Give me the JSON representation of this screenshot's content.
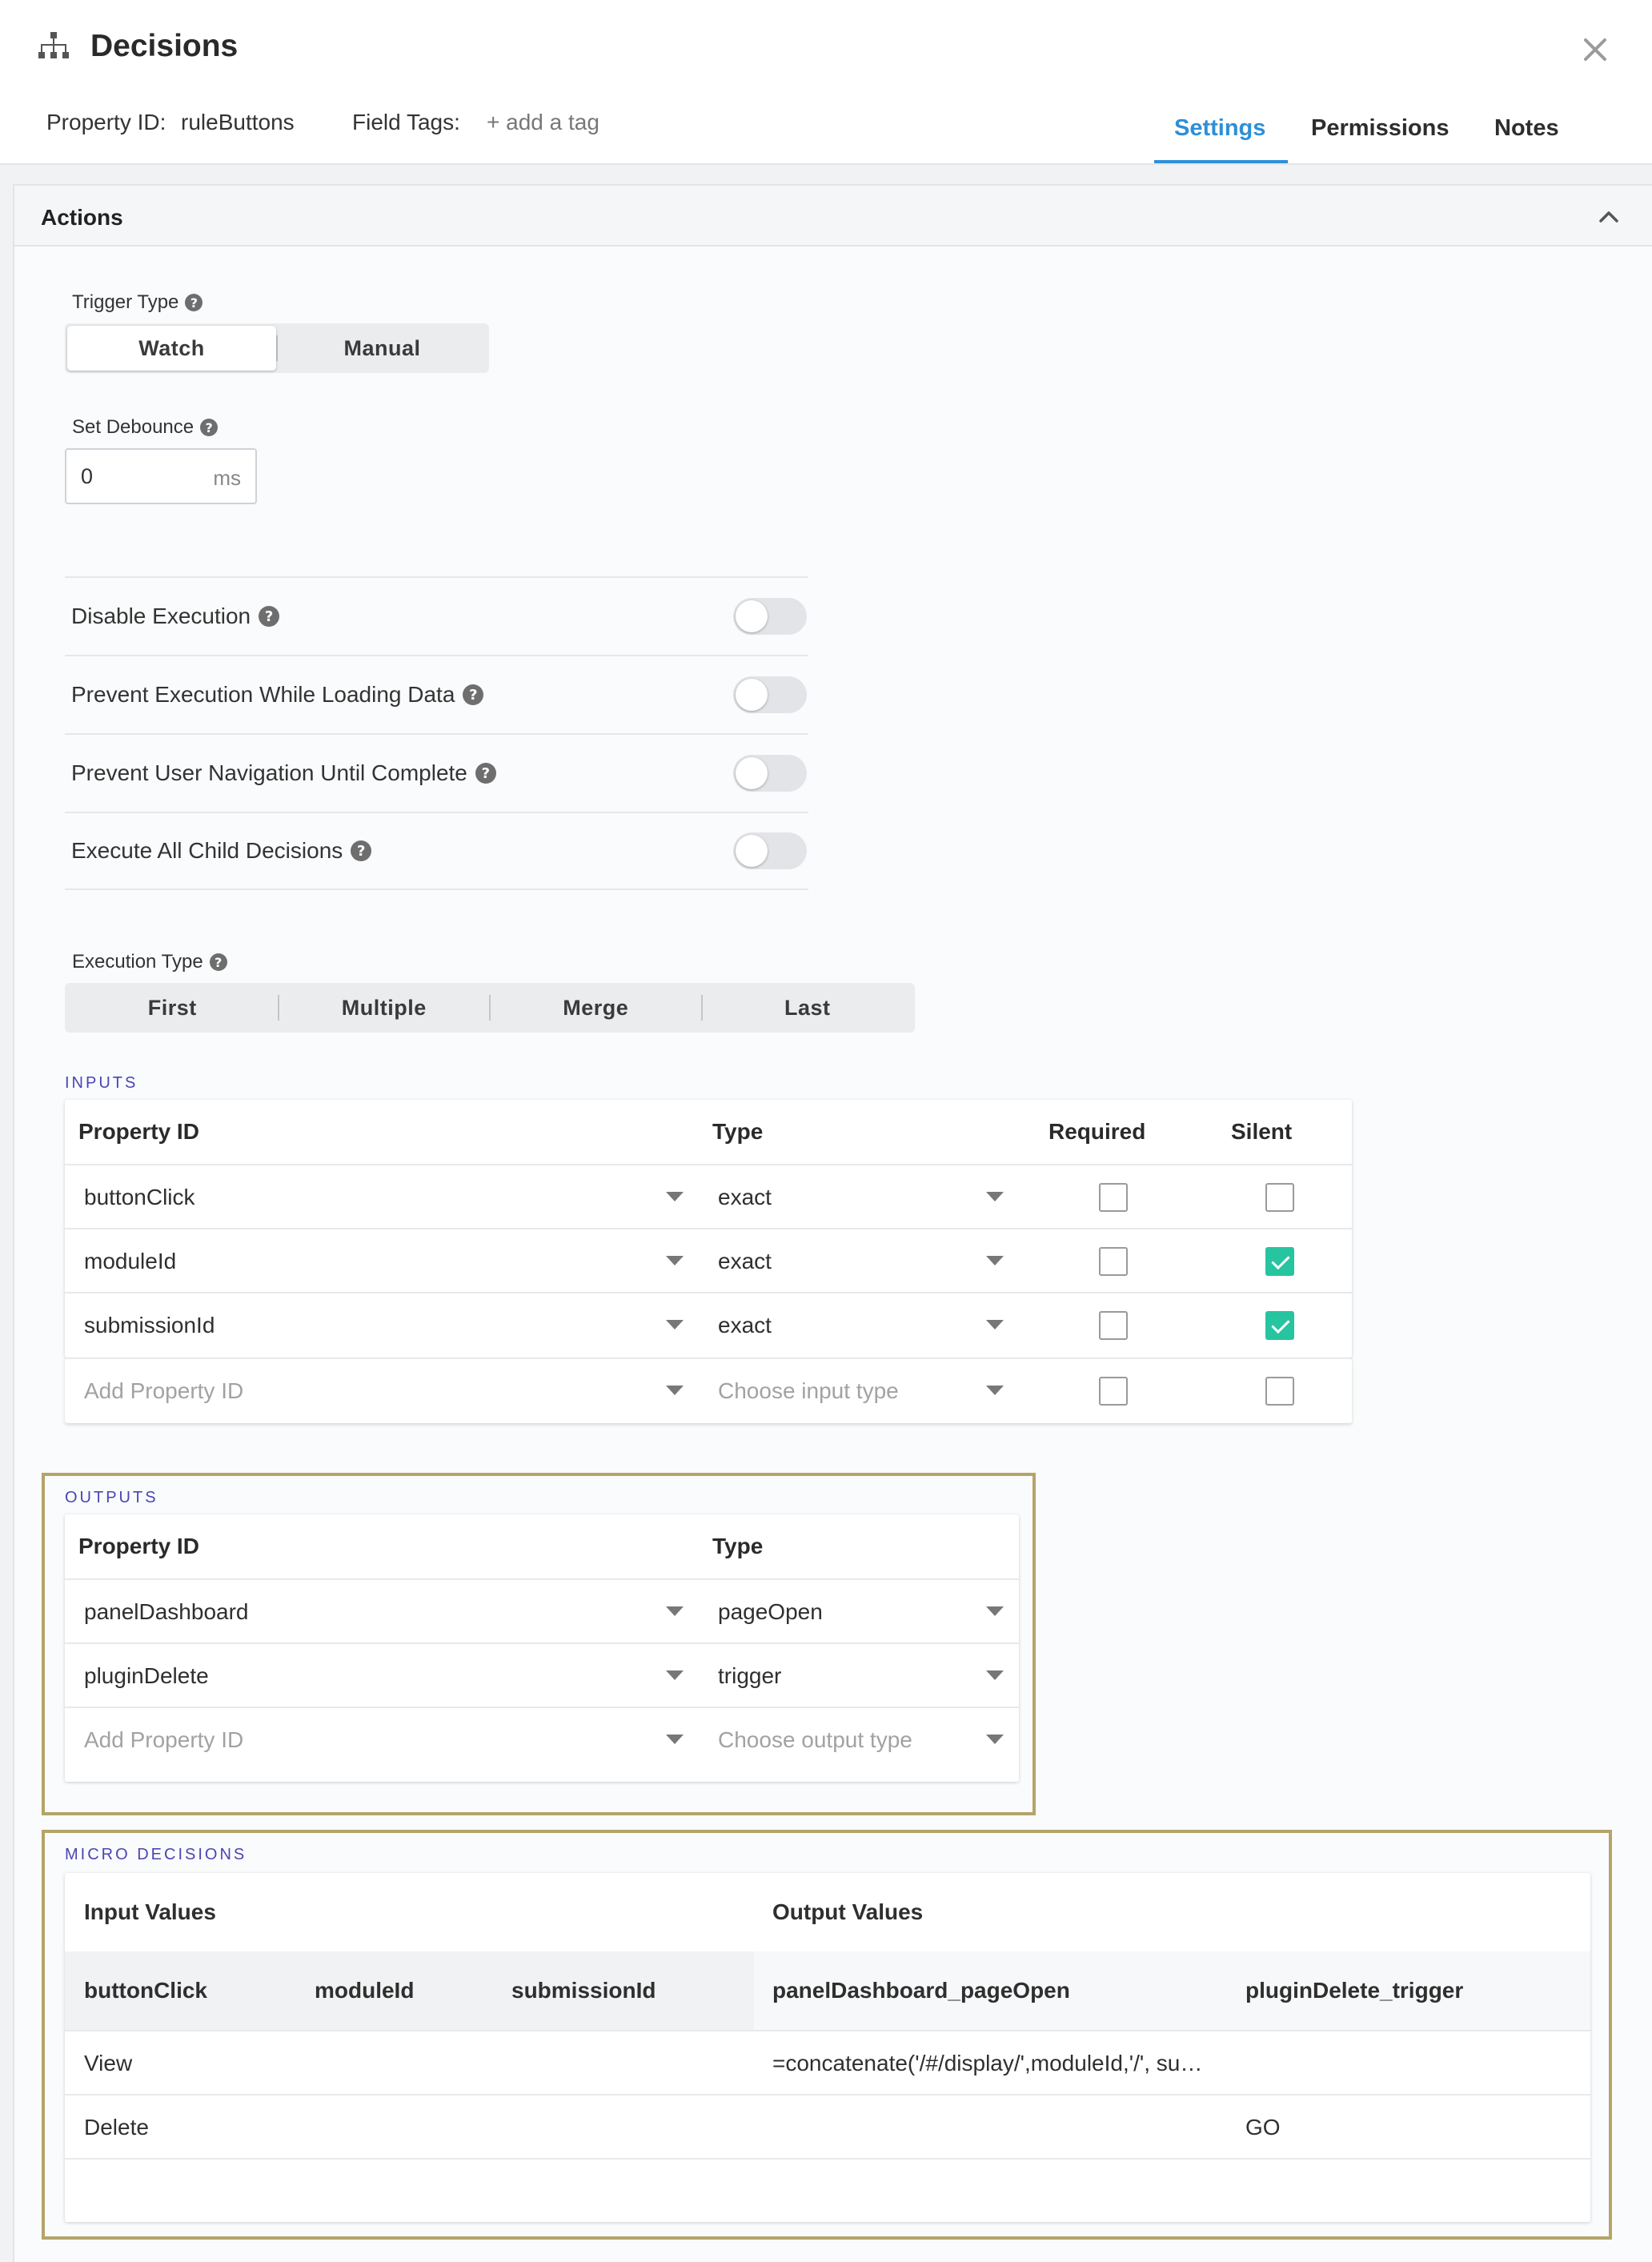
{
  "header": {
    "title": "Decisions",
    "property_id_label": "Property ID:",
    "property_id_value": "ruleButtons",
    "field_tags_label": "Field Tags:",
    "add_tag": "+ add a tag",
    "tabs": [
      {
        "label": "Settings",
        "active": true
      },
      {
        "label": "Permissions",
        "active": false
      },
      {
        "label": "Notes",
        "active": false
      }
    ]
  },
  "panel": {
    "title": "Actions"
  },
  "trigger_type": {
    "label": "Trigger Type",
    "options": [
      "Watch",
      "Manual"
    ],
    "selected": "Watch"
  },
  "debounce": {
    "label": "Set Debounce",
    "value": "0",
    "unit": "ms"
  },
  "toggles": [
    {
      "label": "Disable Execution",
      "on": false
    },
    {
      "label": "Prevent Execution While Loading Data",
      "on": false
    },
    {
      "label": "Prevent User Navigation Until Complete",
      "on": false
    },
    {
      "label": "Execute All Child Decisions",
      "on": false
    }
  ],
  "execution_type": {
    "label": "Execution Type",
    "options": [
      "First",
      "Multiple",
      "Merge",
      "Last"
    ]
  },
  "inputs": {
    "section_label": "INPUTS",
    "columns": [
      "Property ID",
      "Type",
      "Required",
      "Silent"
    ],
    "rows": [
      {
        "property_id": "buttonClick",
        "type": "exact",
        "required": false,
        "silent": false
      },
      {
        "property_id": "moduleId",
        "type": "exact",
        "required": false,
        "silent": true
      },
      {
        "property_id": "submissionId",
        "type": "exact",
        "required": false,
        "silent": true
      }
    ],
    "add_property_placeholder": "Add Property ID",
    "add_type_placeholder": "Choose input type"
  },
  "outputs": {
    "section_label": "OUTPUTS",
    "columns": [
      "Property ID",
      "Type"
    ],
    "rows": [
      {
        "property_id": "panelDashboard",
        "type": "pageOpen"
      },
      {
        "property_id": "pluginDelete",
        "type": "trigger"
      }
    ],
    "add_property_placeholder": "Add Property ID",
    "add_type_placeholder": "Choose output type"
  },
  "micro_decisions": {
    "section_label": "MICRO DECISIONS",
    "input_values_label": "Input Values",
    "output_values_label": "Output Values",
    "input_columns": [
      "buttonClick",
      "moduleId",
      "submissionId"
    ],
    "output_columns": [
      "panelDashboard_pageOpen",
      "pluginDelete_trigger"
    ],
    "rows": [
      {
        "buttonClick": "View",
        "moduleId": "",
        "submissionId": "",
        "panelDashboard_pageOpen": "=concatenate('/#/display/',moduleId,'/', su…",
        "pluginDelete_trigger": ""
      },
      {
        "buttonClick": "Delete",
        "moduleId": "",
        "submissionId": "",
        "panelDashboard_pageOpen": "",
        "pluginDelete_trigger": "GO"
      }
    ]
  },
  "colors": {
    "accent": "#2d8fd8",
    "section_label": "#4b44b5",
    "checkbox_on": "#27c4a0",
    "highlight": "#b5a468"
  }
}
